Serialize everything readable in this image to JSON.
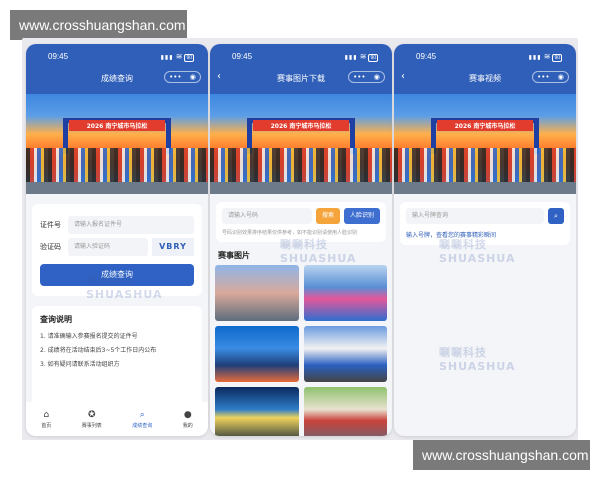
{
  "watermark": {
    "site": "www.crosshuangshan.com",
    "logo_cn": "唰唰科技",
    "logo_en": "SHUASHUA"
  },
  "status": {
    "time": "09:45",
    "signal": "▮▮▮",
    "wifi": "≋",
    "battery": "90"
  },
  "banner": {
    "arch_text": "2026 南宁城市马拉松"
  },
  "phone1": {
    "title": "成绩查询",
    "form": {
      "id_label": "证件号",
      "id_placeholder": "请输入报名证件号",
      "code_label": "验证码",
      "code_placeholder": "请输入验证码",
      "captcha": "VBRY",
      "submit": "成绩查询"
    },
    "notes": {
      "title": "查询说明",
      "items": [
        "1. 请准确输入参赛报名提交的证件号",
        "2. 成绩将在活动结束后3~5个工作日内公布",
        "3. 如有疑问请联系活动组织方"
      ]
    },
    "tabs": [
      {
        "label": "首页",
        "icon": "home-icon"
      },
      {
        "label": "赛事列表",
        "icon": "medal-icon"
      },
      {
        "label": "成绩查询",
        "icon": "search-doc-icon"
      },
      {
        "label": "我的",
        "icon": "user-icon"
      }
    ]
  },
  "phone2": {
    "title": "赛事图片下载",
    "search_placeholder": "请输入号码",
    "btn_search": "搜索",
    "btn_face": "人脸识别",
    "hint": "号码识别效果排序结果仅供参考，如不能识别请使用人脸识别",
    "section": "赛事图片"
  },
  "phone3": {
    "title": "赛事视频",
    "search_placeholder": "输入号牌查询",
    "hint_prefix": "输入号牌，",
    "hint_link": "查看您的赛事精彩瞬间"
  }
}
